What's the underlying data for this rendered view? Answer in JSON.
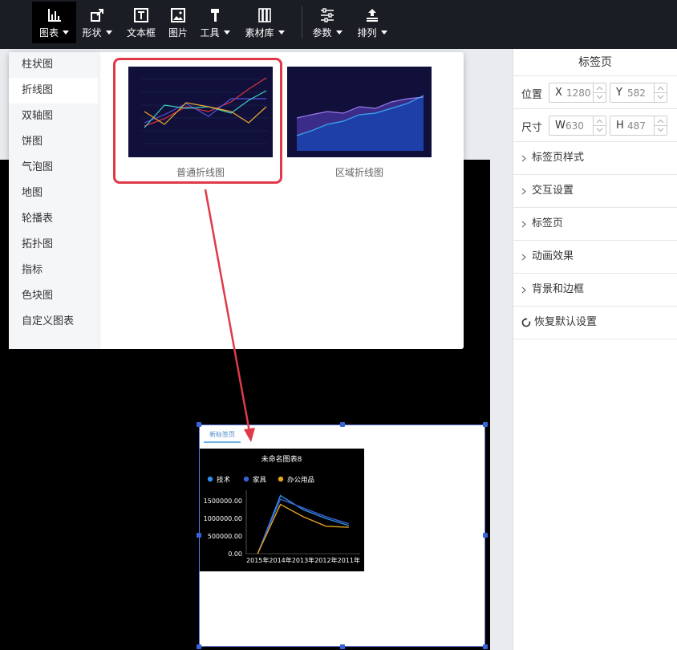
{
  "toolbar": {
    "items": [
      {
        "label": "图表",
        "icon": "bar-chart-icon",
        "has_caret": true
      },
      {
        "label": "形状",
        "icon": "shape-icon",
        "has_caret": true
      },
      {
        "label": "文本框",
        "icon": "textbox-icon",
        "has_caret": false
      },
      {
        "label": "图片",
        "icon": "image-icon",
        "has_caret": false
      },
      {
        "label": "工具",
        "icon": "hammer-icon",
        "has_caret": true
      },
      {
        "label": "素材库",
        "icon": "library-icon",
        "has_caret": true
      },
      {
        "label": "参数",
        "icon": "sliders-icon",
        "has_caret": true
      },
      {
        "label": "排列",
        "icon": "arrange-icon",
        "has_caret": true
      }
    ]
  },
  "dropdown": {
    "categories": [
      "柱状图",
      "折线图",
      "双轴图",
      "饼图",
      "气泡图",
      "地图",
      "轮播表",
      "拓扑图",
      "指标",
      "色块图",
      "自定义图表"
    ],
    "active_category": "折线图",
    "thumbnails": [
      {
        "label": "普通折线图",
        "selected": true
      },
      {
        "label": "区域折线图",
        "selected": false
      }
    ]
  },
  "panel": {
    "title": "标签页",
    "position_label": "位置",
    "size_label": "尺寸",
    "x": {
      "prefix": "X",
      "value": "1280"
    },
    "y": {
      "prefix": "Y",
      "value": "582"
    },
    "w": {
      "prefix": "W",
      "value": "630"
    },
    "h": {
      "prefix": "H",
      "value": "487"
    },
    "sections": [
      "标签页样式",
      "交互设置",
      "标签页",
      "动画效果",
      "背景和边框"
    ],
    "reset_label": "恢复默认设置"
  },
  "tab_component": {
    "tab_label": "新标签页"
  },
  "colors": {
    "toolbar_bg": "#1b1d24",
    "highlight": "#e0394a",
    "selection": "#3a62d9"
  },
  "chart_data": {
    "type": "line",
    "title": "未命名图表8",
    "categories": [
      "2015年",
      "2014年",
      "2013年",
      "2012年",
      "2011年"
    ],
    "series": [
      {
        "name": "技术",
        "color": "#2f8fe8",
        "values": [
          0,
          1650000,
          1250000,
          1000000,
          800000
        ]
      },
      {
        "name": "家具",
        "color": "#3a5fd0",
        "values": [
          0,
          1550000,
          1300000,
          1050000,
          850000
        ]
      },
      {
        "name": "办公用品",
        "color": "#e7a21e",
        "values": [
          0,
          1400000,
          1050000,
          780000,
          750000
        ]
      }
    ],
    "yticks": [
      "0.00",
      "500000.00",
      "1000000.00",
      "1500000.00"
    ],
    "ylim": [
      0,
      1800000
    ],
    "legend": "top-left"
  }
}
